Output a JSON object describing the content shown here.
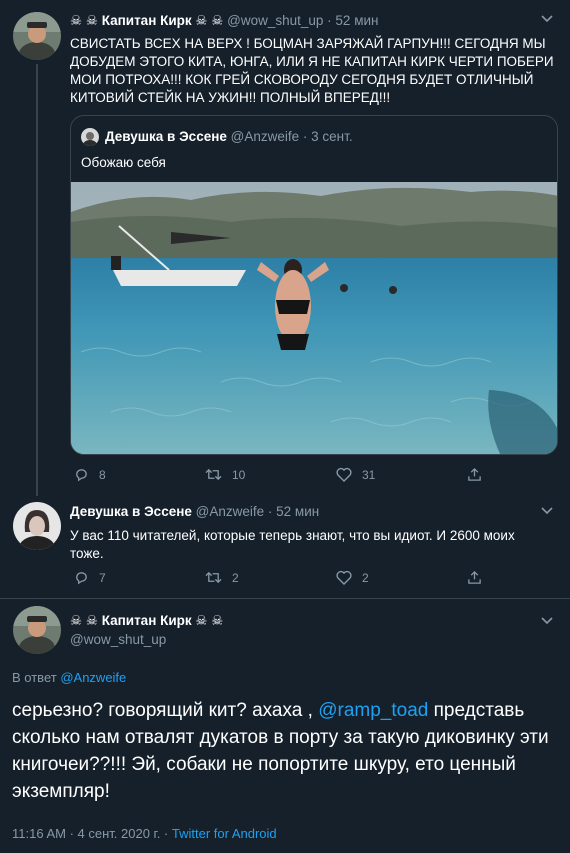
{
  "tweet1": {
    "name": "☠ ☠ Капитан Кирк ☠ ☠",
    "handle": "@wow_shut_up",
    "sep": "·",
    "time": "52 мин",
    "text": "СВИСТАТЬ ВСЕХ НА ВЕРХ ! БОЦМАН ЗАРЯЖАЙ ГАРПУН!!! СЕГОДНЯ МЫ ДОБУДЕМ ЭТОГО КИТА, ЮНГА, ИЛИ Я НЕ КАПИТАН КИРК ЧЕРТИ ПОБЕРИ МОИ ПОТРОХА!!! КОК ГРЕЙ СКОВОРОДУ СЕГОДНЯ БУДЕТ ОТЛИЧНЫЙ КИТОВИЙ СТЕЙК НА УЖИН!! ПОЛНЫЙ ВПЕРЕД!!!",
    "quote": {
      "name": "Девушка в Эссене",
      "handle": "@Anzweife",
      "sep": "·",
      "time": "3 сент.",
      "text": "Обожаю себя"
    },
    "actions": {
      "replies": "8",
      "retweets": "10",
      "likes": "31"
    }
  },
  "tweet2": {
    "name": "Девушка в Эссене",
    "handle": "@Anzweife",
    "sep": "·",
    "time": "52 мин",
    "text": "У вас 110 читателей, которые теперь знают, что вы идиот. И 2600 моих тоже.",
    "actions": {
      "replies": "7",
      "retweets": "2",
      "likes": "2"
    }
  },
  "main_tweet": {
    "name": "☠ ☠ Капитан Кирк ☠ ☠",
    "handle": "@wow_shut_up",
    "reply_prefix": "В ответ",
    "reply_to": "@Anzweife",
    "text_before": "серьезно? говорящий кит? ахаха ,",
    "mention": "@ramp_toad",
    "text_after": "представь сколько нам отвалят дукатов в порту за такую диковинку эти книгочеи??!!! Эй, собаки не попортите шкуру, ето ценный экземпляр!",
    "timestamp": "11:16 AM · 4 сент. 2020 г. ·",
    "source": "Twitter for Android"
  },
  "colors": {
    "background": "#15202b",
    "border": "#38444d",
    "secondary_text": "#8899a6",
    "link": "#1da1f2"
  }
}
